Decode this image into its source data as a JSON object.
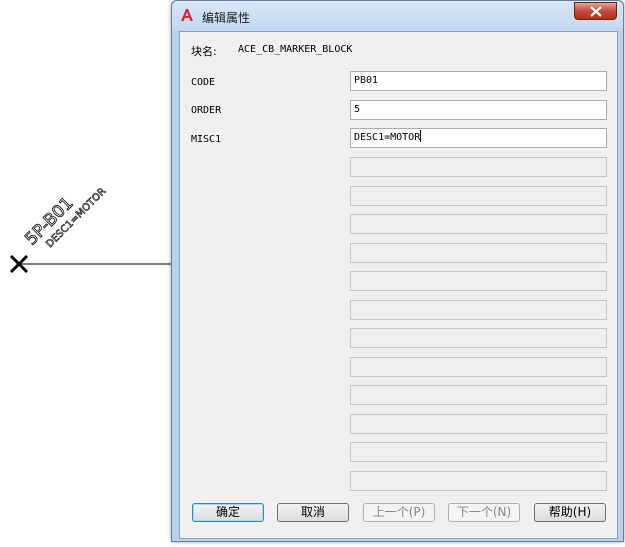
{
  "canvas": {
    "tag_text": "5P-B01",
    "desc_text": "DESC1=MOTOR"
  },
  "dialog": {
    "title": "编辑属性",
    "block_name_label": "块名:",
    "block_name_value": "ACE_CB_MARKER_BLOCK",
    "attributes": [
      {
        "tag": "CODE",
        "value": "PB01"
      },
      {
        "tag": "ORDER",
        "value": "5"
      },
      {
        "tag": "MISC1",
        "value": "DESC1=MOTOR"
      }
    ],
    "empty_field_count": 12,
    "buttons": {
      "ok": "确定",
      "cancel": "取消",
      "prev": "上一个(P)",
      "next": "下一个(N)",
      "help": "帮助(H)"
    }
  },
  "colors": {
    "title_bar": "#c3d8ee",
    "close_button": "#c5473a",
    "dialog_face": "#f0f0f0",
    "app_icon": "#d9232e"
  }
}
